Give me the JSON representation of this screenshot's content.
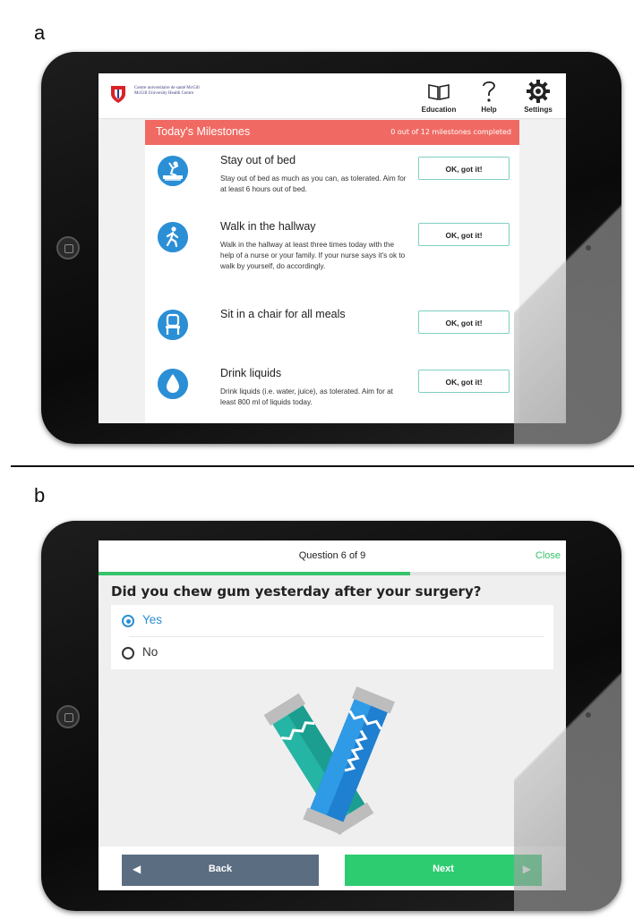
{
  "panels": {
    "a": {
      "letter": "a"
    },
    "b": {
      "letter": "b"
    }
  },
  "panel_a": {
    "logo": {
      "line1": "Centre universitaire de santé McGill",
      "line2": "McGill University Health Centre"
    },
    "nav": [
      {
        "label": "Education",
        "icon": "book-icon"
      },
      {
        "label": "Help",
        "icon": "question-icon"
      },
      {
        "label": "Settings",
        "icon": "gear-icon"
      }
    ],
    "milestones": {
      "title": "Today's Milestones",
      "count_text": "0 out of 12 milestones completed",
      "items": [
        {
          "name": "Stay out of bed",
          "description": "Stay out of bed as much as you can, as tolerated. Aim for at least 6 hours out of bed.",
          "button": "OK, got it!",
          "icon": "out-of-bed-icon"
        },
        {
          "name": "Walk in the hallway",
          "description": "Walk in the hallway at least three times today with the help of a nurse or your family. If your nurse says it's ok to walk by yourself, do accordingly.",
          "button": "OK, got it!",
          "icon": "walking-person-icon"
        },
        {
          "name": "Sit in a chair for all meals",
          "description": "",
          "button": "OK, got it!",
          "icon": "chair-icon"
        },
        {
          "name": "Drink liquids",
          "description": "Drink liquids (i.e. water, juice), as tolerated. Aim for at least 800 ml of liquids today.",
          "button": "OK, got it!",
          "icon": "water-drop-icon"
        }
      ]
    },
    "colors": {
      "header": "#f06a63",
      "icon_blue": "#2b8fd6",
      "button_border": "#7ed0c2"
    }
  },
  "panel_b": {
    "question_counter": "Question 6 of 9",
    "close_label": "Close",
    "progress_fraction": 0.667,
    "question": "Did you chew gum yesterday after your surgery?",
    "options": [
      {
        "label": "Yes",
        "selected": true
      },
      {
        "label": "No",
        "selected": false
      }
    ],
    "illustration": "chewing-gum-sticks-illustration",
    "back_label": "Back",
    "next_label": "Next",
    "colors": {
      "progress": "#36c36b",
      "back_button": "#5b6d81",
      "next_button": "#2ecc71",
      "selected": "#2b8fd6"
    }
  }
}
